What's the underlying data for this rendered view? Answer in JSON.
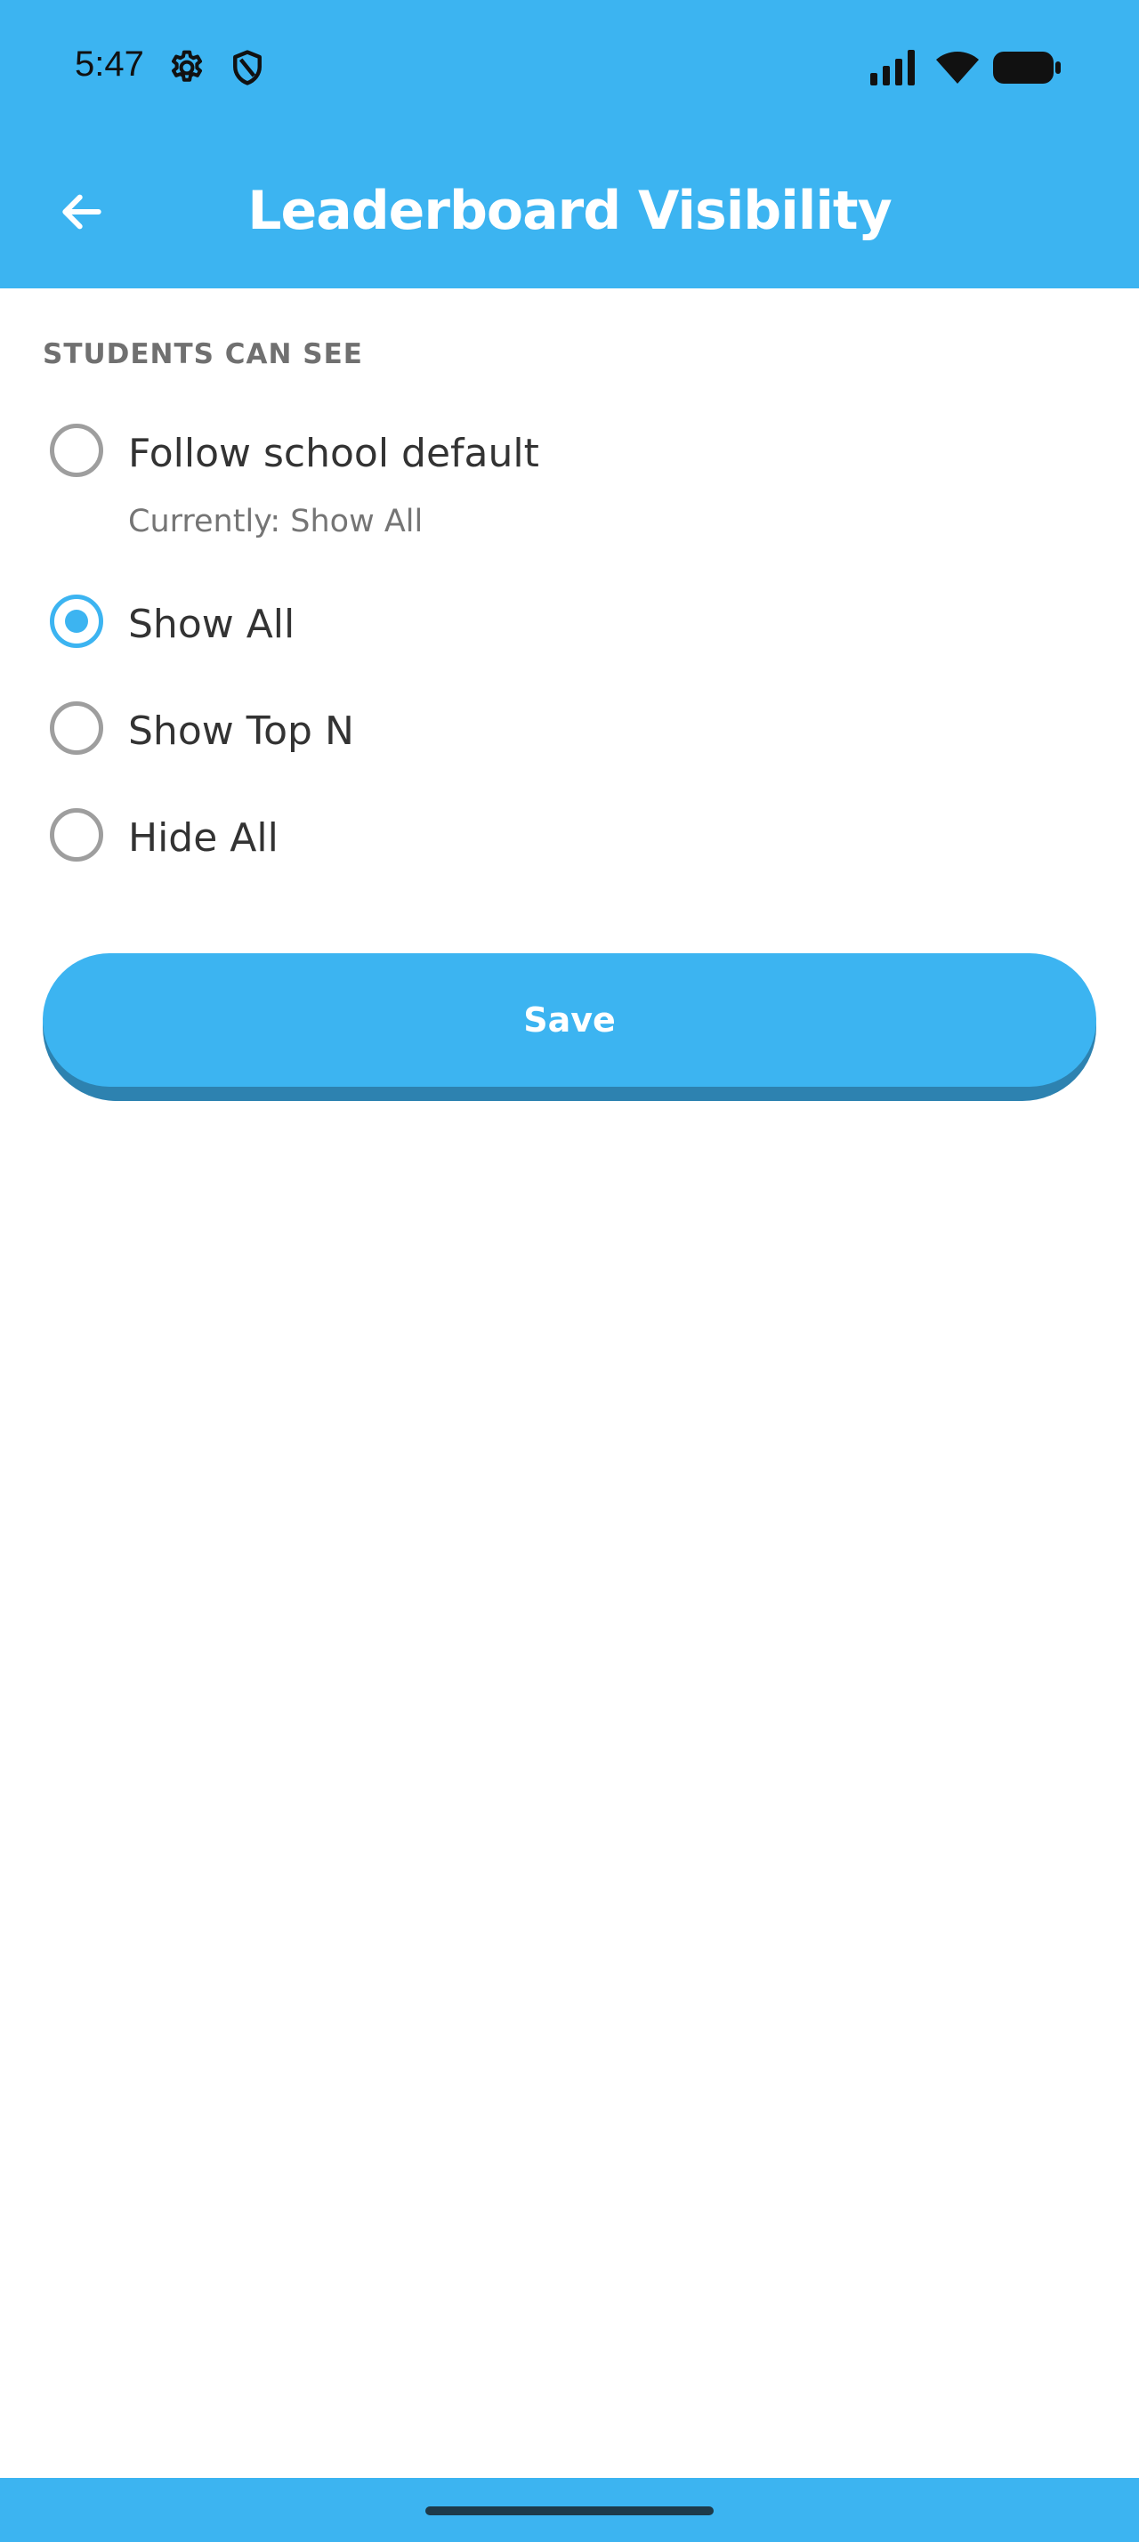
{
  "status_bar": {
    "time": "5:47",
    "icons": [
      "gear-icon",
      "shield-icon",
      "signal-icon",
      "wifi-icon",
      "battery-icon"
    ]
  },
  "app_bar": {
    "title": "Leaderboard Visibility",
    "back_icon": "arrow-left-icon"
  },
  "section": {
    "header": "STUDENTS CAN SEE"
  },
  "options": [
    {
      "label": "Follow school default",
      "sublabel": "Currently: Show All",
      "checked": false
    },
    {
      "label": "Show All",
      "checked": true
    },
    {
      "label": "Show Top N",
      "checked": false
    },
    {
      "label": "Hide All",
      "checked": false
    }
  ],
  "save": {
    "label": "Save"
  },
  "colors": {
    "accent": "#3cb4f1",
    "accent_dark": "#2d82b0",
    "radio_unchecked": "#9e9e9e"
  }
}
